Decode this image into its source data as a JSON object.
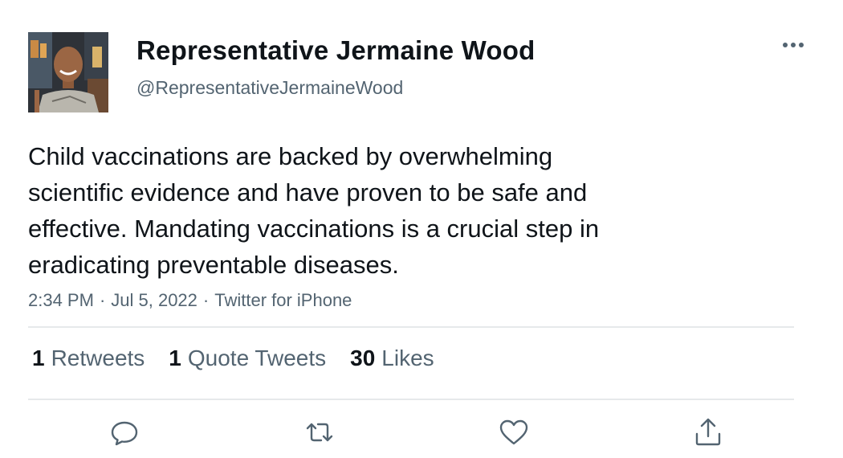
{
  "author": {
    "display_name": "Representative Jermaine Wood",
    "handle": "@RepresentativeJermaineWood"
  },
  "tweet": {
    "text": "Child vaccinations are backed by overwhelming\nscientific evidence and have proven to be safe and\neffective. Mandating vaccinations is a crucial step in\neradicating preventable diseases.",
    "time": "2:34 PM",
    "separator": "·",
    "date": "Jul 5, 2022",
    "source": "Twitter for iPhone"
  },
  "stats": {
    "retweets_count": "1",
    "retweets_label": "Retweets",
    "quotes_count": "1",
    "quotes_label": "Quote Tweets",
    "likes_count": "30",
    "likes_label": "Likes"
  },
  "icons": {
    "more": "more-horizontal-icon",
    "reply": "reply-icon",
    "retweet": "retweet-icon",
    "like": "heart-icon",
    "share": "share-icon"
  },
  "colors": {
    "text": "#0f1419",
    "secondary": "#536471",
    "divider": "#e6e9eb"
  }
}
